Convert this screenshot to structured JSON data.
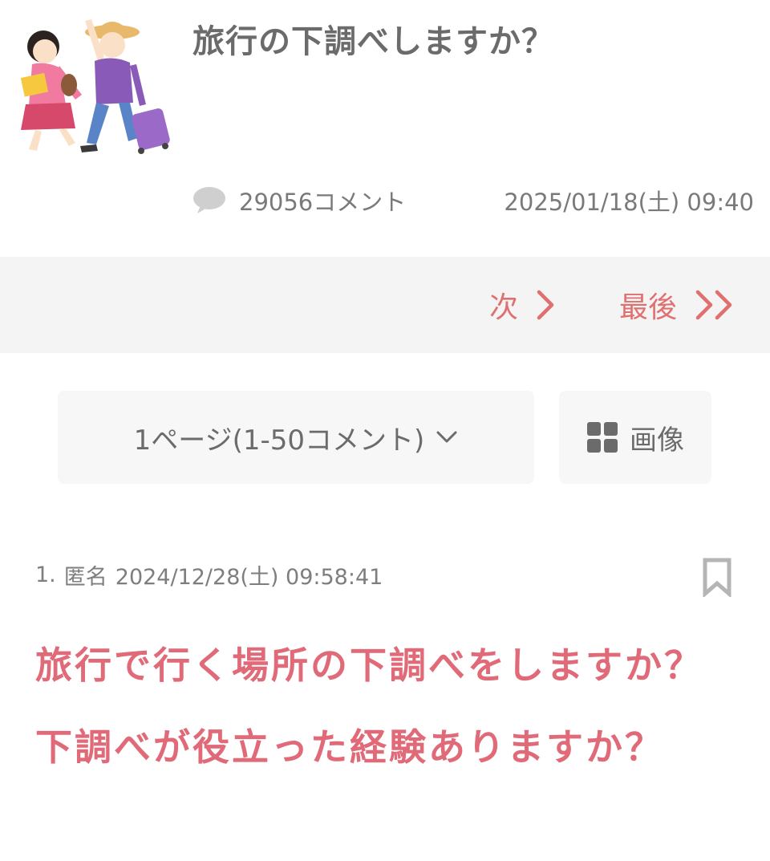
{
  "thread": {
    "title": "旅行の下調べしますか？",
    "comment_count": "29056コメント",
    "date": "2025/01/18(土) 09:40",
    "thumbnail_icon": "travel-couple-illustration"
  },
  "pager": {
    "next_label": "次",
    "last_label": "最後",
    "accent_color": "#e07070"
  },
  "controls": {
    "page_select_label": "1ページ(1-50コメント)",
    "image_button_label": "画像"
  },
  "post": {
    "number": "1.",
    "author": "匿名",
    "timestamp": "2024/12/28(土) 09:58:41",
    "body": "旅行で行く場所の下調べをしますか？下調べが役立った経験ありますか？",
    "body_color": "#e06a78"
  }
}
